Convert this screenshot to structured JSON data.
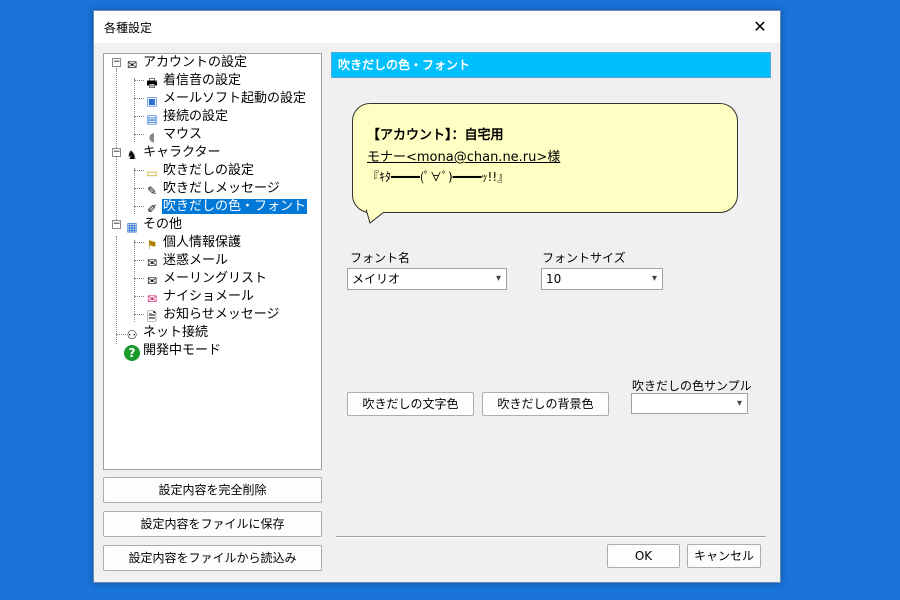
{
  "window": {
    "title": "各種設定"
  },
  "tree": {
    "items": [
      {
        "label": "アカウントの設定",
        "icon": "mail-lock-icon"
      },
      {
        "label": "着信音の設定",
        "icon": "speaker-icon"
      },
      {
        "label": "メールソフト起動の設定",
        "icon": "mail-app-icon"
      },
      {
        "label": "接続の設定",
        "icon": "network-icon"
      },
      {
        "label": "マウス",
        "icon": "mouse-icon"
      },
      {
        "label": "キャラクター",
        "icon": "character-icon"
      },
      {
        "label": "吹きだしの設定",
        "icon": "speech-bubble-icon"
      },
      {
        "label": "吹きだしメッセージ",
        "icon": "edit-icon"
      },
      {
        "label": "吹きだしの色・フォント",
        "icon": "palette-icon"
      },
      {
        "label": "その他",
        "icon": "computer-icon"
      },
      {
        "label": "個人情報保護",
        "icon": "shield-icon"
      },
      {
        "label": "迷惑メール",
        "icon": "envelope-icon"
      },
      {
        "label": "メーリングリスト",
        "icon": "envelope-icon"
      },
      {
        "label": "ナイショメール",
        "icon": "heart-mail-icon"
      },
      {
        "label": "お知らせメッセージ",
        "icon": "note-icon"
      },
      {
        "label": "ネット接続",
        "icon": "network-tree-icon"
      },
      {
        "label": "開発中モード",
        "icon": "help-icon"
      }
    ]
  },
  "left_buttons": {
    "delete_all": "設定内容を完全削除",
    "save_file": "設定内容をファイルに保存",
    "load_file": "設定内容をファイルから読込み"
  },
  "panel": {
    "header": "吹きだしの色・フォント",
    "bubble": {
      "line1": "【アカウント】：自宅用",
      "line2": "モナー<mona@chan.ne.ru>様",
      "line3": "『ｷﾀ━━━━(ﾟ∀ﾟ)━━━━ｯ!!』"
    },
    "font_name_label": "フォント名",
    "font_name_value": "メイリオ",
    "font_size_label": "フォントサイズ",
    "font_size_value": "10",
    "text_color_button": "吹きだしの文字色",
    "bg_color_button": "吹きだしの背景色",
    "sample_label": "吹きだしの色サンプル",
    "sample_value": ""
  },
  "footer": {
    "ok": "OK",
    "cancel": "キャンセル"
  },
  "colors": {
    "header_bg": "#00bfff",
    "bubble_bg": "#ffffc4",
    "selection": "#0078d7"
  }
}
